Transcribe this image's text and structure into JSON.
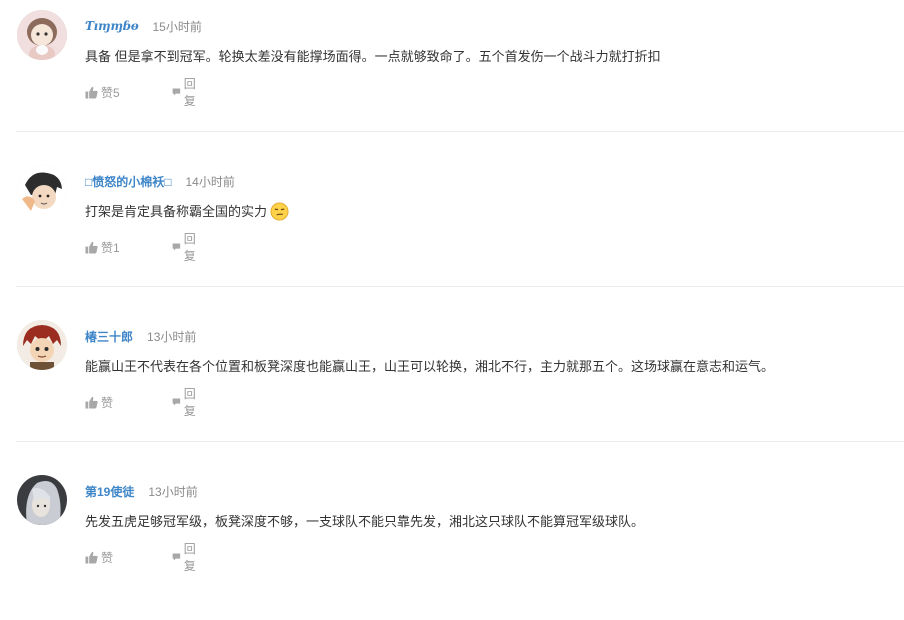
{
  "comments": [
    {
      "username": "Ƭıɱɱɓɵ",
      "time": "15小时前",
      "text": "具备 但是拿不到冠军。轮换太差没有能撑场面得。一点就够致命了。五个首发伤一个战斗力就打折扣",
      "like_label": "赞5",
      "reply_label": "回复",
      "avatar": "plush-girl-avatar"
    },
    {
      "username": "□愤怒的小棉袄□",
      "time": "14小时前",
      "text": "打架是肯定具备称霸全国的实力",
      "emoji": "smirk-emoji",
      "like_label": "赞1",
      "reply_label": "回复",
      "avatar": "sketch-character-avatar"
    },
    {
      "username": "椿三十郎",
      "time": "13小时前",
      "text": "能赢山王不代表在各个位置和板凳深度也能赢山王，山王可以轮换，湘北不行，主力就那五个。这场球赢在意志和运气。",
      "like_label": "赞",
      "reply_label": "回复",
      "avatar": "red-hair-anime-avatar"
    },
    {
      "username": "第19使徒",
      "time": "13小时前",
      "text": "先发五虎足够冠军级，板凳深度不够，一支球队不能只靠先发，湘北这只球队不能算冠军级球队。",
      "like_label": "赞",
      "reply_label": "回复",
      "avatar": "silver-hair-avatar"
    }
  ],
  "colors": {
    "username": "#3f86c8",
    "time": "#8a8a8a",
    "text": "#333333",
    "action": "#999999",
    "divider": "#ececec"
  }
}
